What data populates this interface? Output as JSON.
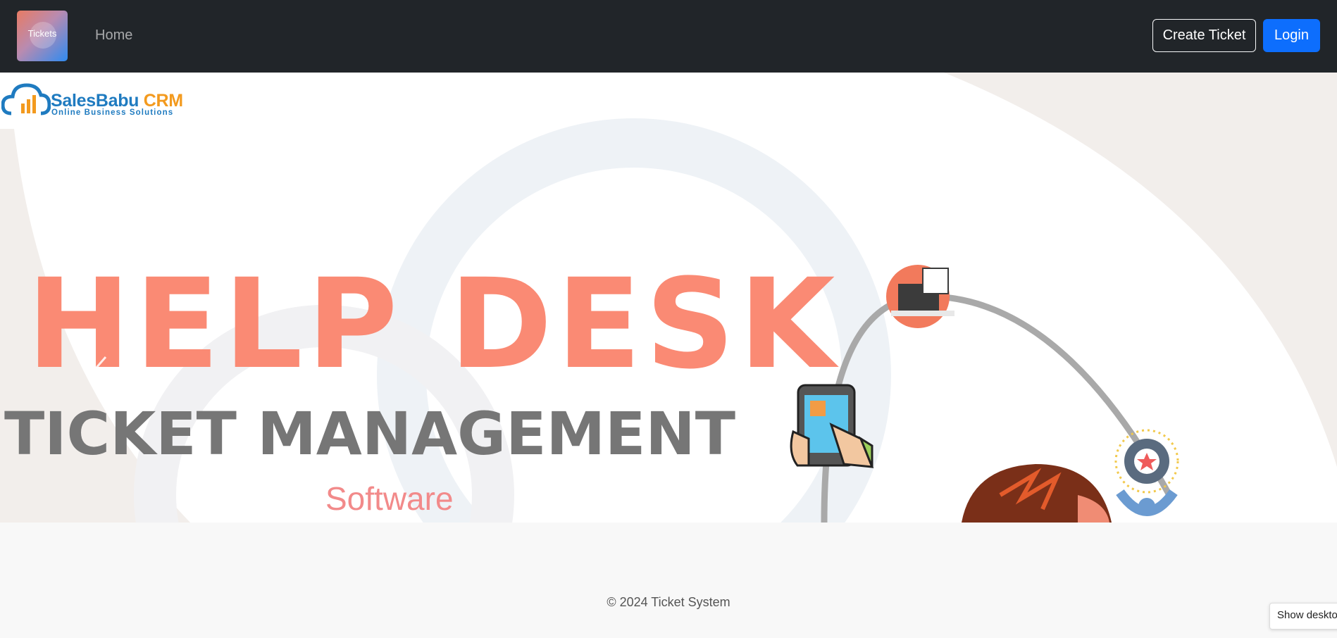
{
  "navbar": {
    "brand_label": "Tickets",
    "home_label": "Home",
    "create_ticket_label": "Create Ticket",
    "login_label": "Login"
  },
  "hero": {
    "logo_name_part1": "SalesBabu ",
    "logo_name_part2": "CRM",
    "logo_tagline": "Online Business Solutions",
    "headline": "HELP DESK",
    "subheadline": "TICKET MANAGEMENT",
    "caption": "Software",
    "prev_icon": "chevron-left-icon",
    "next_icon": "chevron-right-icon"
  },
  "footer": {
    "copyright": "© 2024 Ticket System"
  },
  "overlay": {
    "show_desktop_label": "Show desktop"
  },
  "colors": {
    "navbar_bg": "#212529",
    "primary_button": "#0d6efd",
    "headline": "#fa8a74",
    "subheadline": "#767676",
    "caption": "#f28a8a"
  }
}
